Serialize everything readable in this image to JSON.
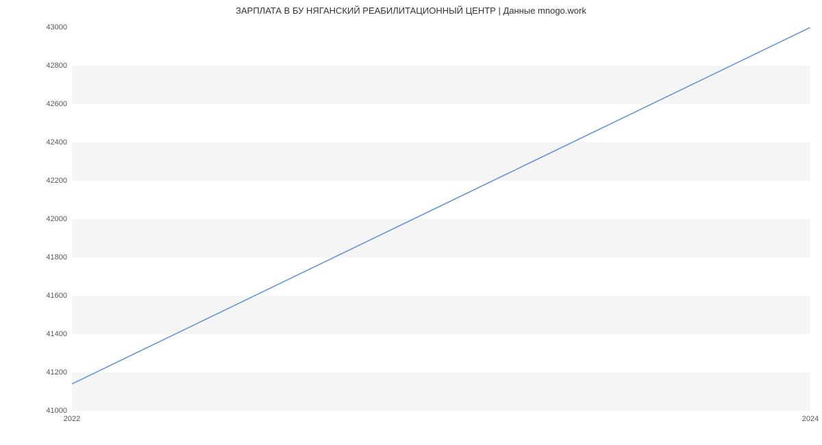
{
  "chart_data": {
    "type": "line",
    "title": "ЗАРПЛАТА В БУ НЯГАНСКИЙ РЕАБИЛИТАЦИОННЫЙ ЦЕНТР | Данные mnogo.work",
    "x": [
      2022,
      2024
    ],
    "values": [
      41140,
      43000
    ],
    "xlabel": "",
    "ylabel": "",
    "xlim": [
      2022,
      2024
    ],
    "ylim": [
      41000,
      43000
    ],
    "x_ticks": [
      2022,
      2024
    ],
    "y_ticks": [
      41000,
      41200,
      41400,
      41600,
      41800,
      42000,
      42200,
      42400,
      42600,
      42800,
      43000
    ],
    "line_color": "#5b8fd6",
    "band_color": "#f5f5f5"
  }
}
